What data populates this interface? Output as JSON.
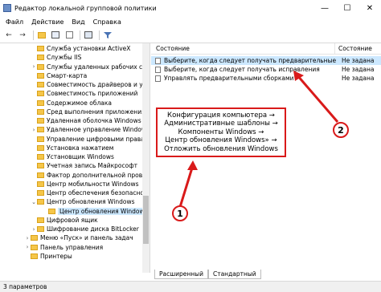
{
  "window": {
    "title": "Редактор локальной групповой политики",
    "min_glyph": "—",
    "max_glyph": "☐",
    "close_glyph": "✕"
  },
  "menu": [
    "Файл",
    "Действие",
    "Вид",
    "Справка"
  ],
  "toolbar_icons": [
    "back-icon",
    "forward-icon",
    "folder-up-icon",
    "show-hide-tree-icon",
    "export-icon",
    "properties-icon",
    "filter-icon"
  ],
  "tree": {
    "items": [
      {
        "label": "Служба установки ActiveX",
        "chev": ""
      },
      {
        "label": "Службы IIS",
        "chev": ""
      },
      {
        "label": "Службы удаленных рабочих сто",
        "chev": "›"
      },
      {
        "label": "Смарт-карта",
        "chev": ""
      },
      {
        "label": "Совместимость драйверов и устр",
        "chev": ""
      },
      {
        "label": "Совместимость приложений",
        "chev": ""
      },
      {
        "label": "Содержимое облака",
        "chev": ""
      },
      {
        "label": "Сред выполнения приложения",
        "chev": ""
      },
      {
        "label": "Удаленная оболочка Windows",
        "chev": ""
      },
      {
        "label": "Удаленное управление Windows",
        "chev": "›"
      },
      {
        "label": "Управление цифровыми правами",
        "chev": ""
      },
      {
        "label": "Установка нажатием",
        "chev": ""
      },
      {
        "label": "Установщик Windows",
        "chev": ""
      },
      {
        "label": "Учетная запись Майкрософт",
        "chev": ""
      },
      {
        "label": "Фактор дополнительной проверк",
        "chev": ""
      },
      {
        "label": "Центр мобильности Windows",
        "chev": ""
      },
      {
        "label": "Центр обеспечения безопасност",
        "chev": ""
      },
      {
        "label": "Центр обновления Windows",
        "chev": "⌄"
      },
      {
        "label": "Центр обновления Windows",
        "chev": "",
        "selected": true,
        "indent": 1
      },
      {
        "label": "Цифровой ящик",
        "chev": ""
      },
      {
        "label": "Шифрование диска BitLocker",
        "chev": "›"
      },
      {
        "label": "Меню «Пуск» и панель задач",
        "chev": "›",
        "level": 0
      },
      {
        "label": "Панель управления",
        "chev": "›",
        "level": 0
      },
      {
        "label": "Принтеры",
        "chev": "",
        "level": 0
      }
    ]
  },
  "list": {
    "col_state": "Состояние",
    "col_status": "Состояние",
    "rows": [
      {
        "text": "Выберите, когда следует получать предварительные сбо...",
        "status": "Не задана",
        "selected": true
      },
      {
        "text": "Выберите, когда следует получать исправления",
        "status": "Не задана"
      },
      {
        "text": "Управлять предварительными сборками",
        "status": "Не задана"
      }
    ]
  },
  "tabs": [
    "Расширенный",
    "Стандартный"
  ],
  "status": "3 параметров",
  "annotation": {
    "lines": [
      "Конфигурация компьютера →",
      "Административные шаблоны →",
      "Компоненты Windows →",
      "Центр обновления Windows» →",
      "Отложить обновления Windows"
    ],
    "badge1": "1",
    "badge2": "2",
    "color": "#d91a1a"
  }
}
